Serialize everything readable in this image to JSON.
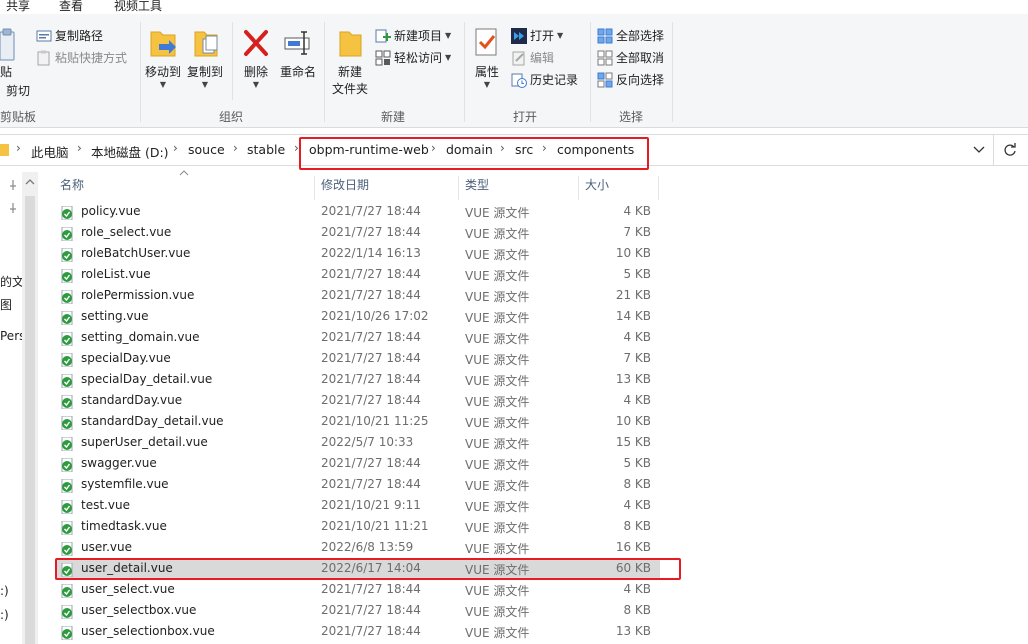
{
  "tabs": [
    "共享",
    "查看",
    "视频工具"
  ],
  "ribbon": {
    "clipboard": {
      "paste_fragment": "贴",
      "cut": "剪切",
      "copy_path": "复制路径",
      "paste_shortcut": "粘贴快捷方式",
      "label": "剪贴板"
    },
    "organize": {
      "move_to": "移动到",
      "copy_to": "复制到",
      "delete": "删除",
      "rename": "重命名",
      "label": "组织"
    },
    "new": {
      "new_folder_line1": "新建",
      "new_folder_line2": "文件夹",
      "new_item": "新建项目",
      "easy_access": "轻松访问",
      "label": "新建"
    },
    "open": {
      "properties": "属性",
      "open": "打开",
      "edit": "编辑",
      "history": "历史记录",
      "label": "打开"
    },
    "select": {
      "select_all": "全部选择",
      "select_none": "全部取消",
      "invert": "反向选择",
      "label": "选择"
    }
  },
  "breadcrumb": [
    "此电脑",
    "本地磁盘 (D:)",
    "souce",
    "stable",
    "obpm-runtime-web",
    "domain",
    "src",
    "components"
  ],
  "nav_pane": {
    "items": [
      "的文件",
      "图",
      "Perso",
      ":)",
      ":)"
    ]
  },
  "columns": {
    "name": "名称",
    "date": "修改日期",
    "type": "类型",
    "size": "大小"
  },
  "files": [
    {
      "name": "policy.vue",
      "date": "2021/7/27 18:44",
      "type": "VUE 源文件",
      "size": "4 KB"
    },
    {
      "name": "role_select.vue",
      "date": "2021/7/27 18:44",
      "type": "VUE 源文件",
      "size": "7 KB"
    },
    {
      "name": "roleBatchUser.vue",
      "date": "2022/1/14 16:13",
      "type": "VUE 源文件",
      "size": "10 KB"
    },
    {
      "name": "roleList.vue",
      "date": "2021/7/27 18:44",
      "type": "VUE 源文件",
      "size": "5 KB"
    },
    {
      "name": "rolePermission.vue",
      "date": "2021/7/27 18:44",
      "type": "VUE 源文件",
      "size": "21 KB"
    },
    {
      "name": "setting.vue",
      "date": "2021/10/26 17:02",
      "type": "VUE 源文件",
      "size": "14 KB"
    },
    {
      "name": "setting_domain.vue",
      "date": "2021/7/27 18:44",
      "type": "VUE 源文件",
      "size": "4 KB"
    },
    {
      "name": "specialDay.vue",
      "date": "2021/7/27 18:44",
      "type": "VUE 源文件",
      "size": "7 KB"
    },
    {
      "name": "specialDay_detail.vue",
      "date": "2021/7/27 18:44",
      "type": "VUE 源文件",
      "size": "13 KB"
    },
    {
      "name": "standardDay.vue",
      "date": "2021/7/27 18:44",
      "type": "VUE 源文件",
      "size": "4 KB"
    },
    {
      "name": "standardDay_detail.vue",
      "date": "2021/10/21 11:25",
      "type": "VUE 源文件",
      "size": "10 KB"
    },
    {
      "name": "superUser_detail.vue",
      "date": "2022/5/7 10:33",
      "type": "VUE 源文件",
      "size": "15 KB"
    },
    {
      "name": "swagger.vue",
      "date": "2021/7/27 18:44",
      "type": "VUE 源文件",
      "size": "5 KB"
    },
    {
      "name": "systemfile.vue",
      "date": "2021/7/27 18:44",
      "type": "VUE 源文件",
      "size": "8 KB"
    },
    {
      "name": "test.vue",
      "date": "2021/10/21 9:11",
      "type": "VUE 源文件",
      "size": "4 KB"
    },
    {
      "name": "timedtask.vue",
      "date": "2021/10/21 11:21",
      "type": "VUE 源文件",
      "size": "8 KB"
    },
    {
      "name": "user.vue",
      "date": "2022/6/8 13:59",
      "type": "VUE 源文件",
      "size": "16 KB"
    },
    {
      "name": "user_detail.vue",
      "date": "2022/6/17 14:04",
      "type": "VUE 源文件",
      "size": "60 KB",
      "selected": true
    },
    {
      "name": "user_select.vue",
      "date": "2021/7/27 18:44",
      "type": "VUE 源文件",
      "size": "4 KB"
    },
    {
      "name": "user_selectbox.vue",
      "date": "2021/7/27 18:44",
      "type": "VUE 源文件",
      "size": "8 KB"
    },
    {
      "name": "user_selectionbox.vue",
      "date": "2021/7/27 18:44",
      "type": "VUE 源文件",
      "size": "13 KB"
    }
  ],
  "colors": {
    "highlight": "#e51c23",
    "selected_row": "#d9d9d9",
    "vue_icon": "#2e9b3e"
  },
  "icons": [
    "paste-icon",
    "cut-icon",
    "copy-path-icon",
    "paste-shortcut-icon",
    "move-to-icon",
    "copy-to-icon",
    "delete-icon",
    "rename-icon",
    "new-folder-icon",
    "new-item-icon",
    "easy-access-icon",
    "properties-icon",
    "open-icon",
    "edit-icon",
    "history-icon",
    "select-all-icon",
    "select-none-icon",
    "invert-selection-icon",
    "folder-icon",
    "chevron-down-icon",
    "refresh-icon",
    "pin-icon",
    "vue-file-icon",
    "sort-ascending-icon"
  ]
}
